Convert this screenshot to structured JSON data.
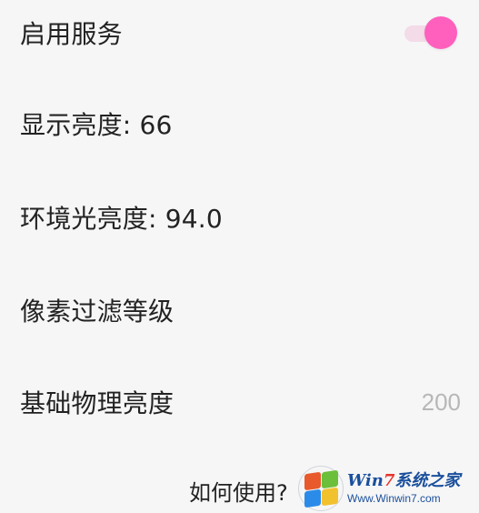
{
  "settings": [
    {
      "label": "启用服务",
      "control": "toggle",
      "enabled": true
    },
    {
      "label": "显示亮度: 66"
    },
    {
      "label": "环境光亮度: 94.0"
    },
    {
      "label": "像素过滤等级"
    },
    {
      "label": "基础物理亮度",
      "value": "200"
    }
  ],
  "help": {
    "label": "如何使用?"
  },
  "watermark": {
    "title_prefix": "Win",
    "title_num": "7",
    "title_suffix": "系统之家",
    "subtitle": "Www.Winwin7.com"
  },
  "colors": {
    "toggle_knob": "#ff5fbd",
    "toggle_track": "#f3dbe8",
    "background": "#f6f6f6",
    "value_text": "#b7b7b7"
  }
}
